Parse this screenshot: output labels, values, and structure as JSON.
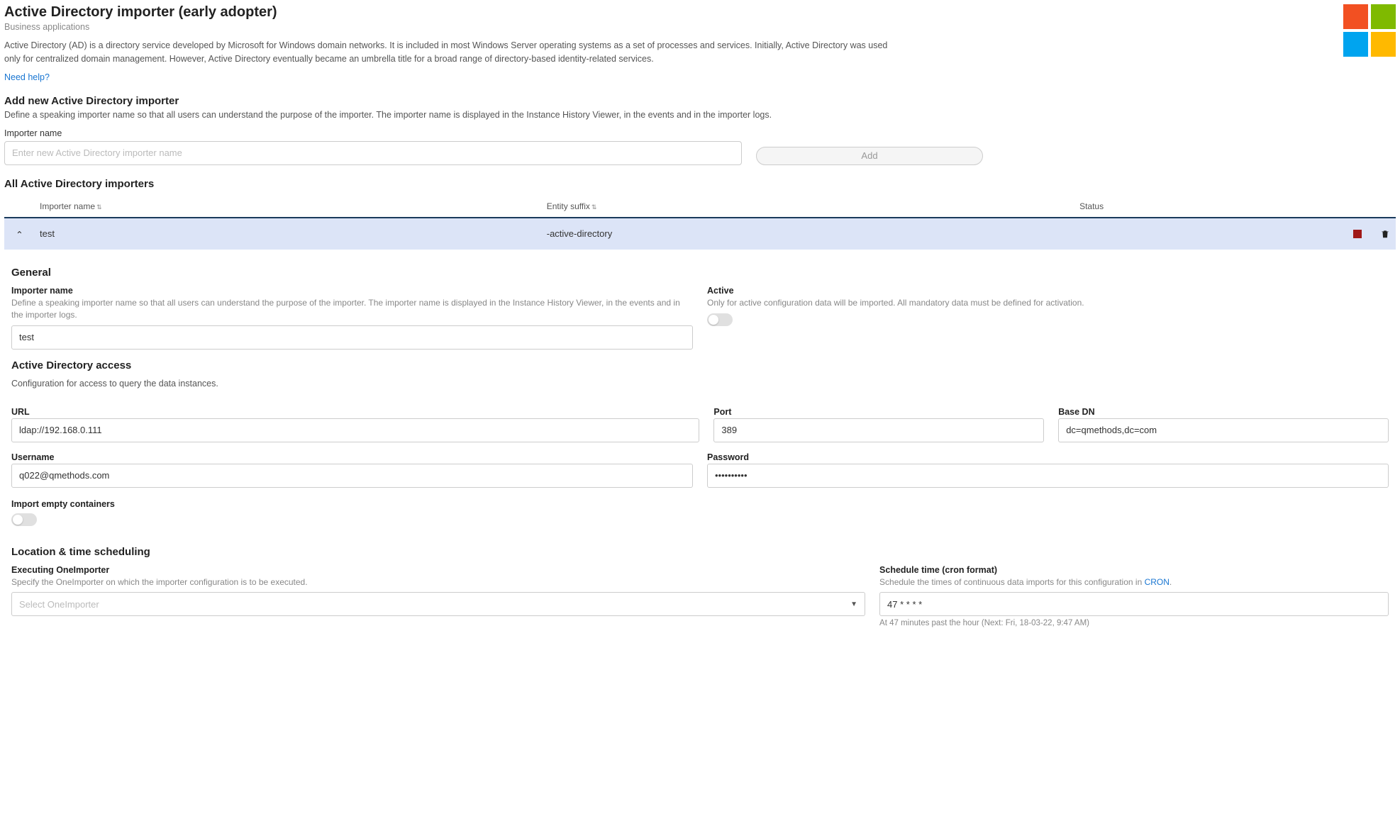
{
  "header": {
    "title": "Active Directory importer (early adopter)",
    "subtitle": "Business applications",
    "description": "Active Directory (AD) is a directory service developed by Microsoft for Windows domain networks. It is included in most Windows Server operating systems as a set of processes and services. Initially, Active Directory was used only for centralized domain management. However, Active Directory eventually became an umbrella title for a broad range of directory-based identity-related services.",
    "help_link": "Need help?"
  },
  "add_section": {
    "title": "Add new Active Directory importer",
    "description": "Define a speaking importer name so that all users can understand the purpose of the importer. The importer name is displayed in the Instance History Viewer, in the events and in the importer logs.",
    "label": "Importer name",
    "placeholder": "Enter new Active Directory importer name",
    "add_button": "Add"
  },
  "list_section": {
    "title": "All Active Directory importers",
    "columns": {
      "name": "Importer name",
      "suffix": "Entity suffix",
      "status": "Status"
    },
    "rows": [
      {
        "name": "test",
        "suffix": "-active-directory"
      }
    ]
  },
  "detail": {
    "general": {
      "title": "General",
      "name_label": "Importer name",
      "name_hint": "Define a speaking importer name so that all users can understand the purpose of the importer. The importer name is displayed in the Instance History Viewer, in the events and in the importer logs.",
      "name_value": "test",
      "active_label": "Active",
      "active_hint": "Only for active configuration data will be imported. All mandatory data must be defined for activation."
    },
    "access": {
      "title": "Active Directory access",
      "subtitle": "Configuration for access to query the data instances.",
      "url_label": "URL",
      "url_value": "ldap://192.168.0.111",
      "port_label": "Port",
      "port_value": "389",
      "basedn_label": "Base DN",
      "basedn_value": "dc=qmethods,dc=com",
      "user_label": "Username",
      "user_value": "q022@qmethods.com",
      "pwd_label": "Password",
      "pwd_value": "••••••••••",
      "empty_label": "Import empty containers"
    },
    "schedule": {
      "title": "Location & time scheduling",
      "exec_label": "Executing OneImporter",
      "exec_hint": "Specify the OneImporter on which the importer configuration is to be executed.",
      "exec_placeholder": "Select OneImporter",
      "cron_label": "Schedule time (cron format)",
      "cron_hint_prefix": "Schedule the times of continuous data imports for this configuration in ",
      "cron_link": "CRON",
      "cron_value": "47 * * * *",
      "cron_next": "At 47 minutes past the hour (Next: Fri, 18-03-22, 9:47 AM)"
    }
  }
}
